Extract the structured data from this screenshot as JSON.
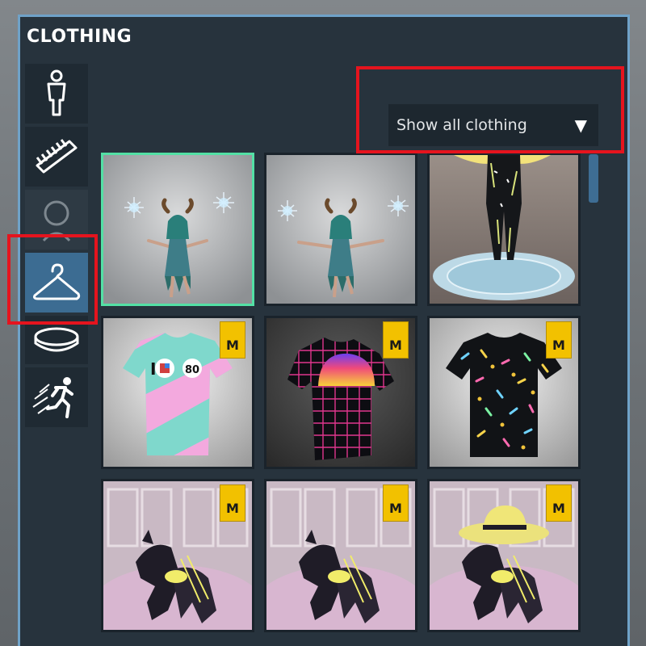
{
  "panel": {
    "title": "CLOTHING"
  },
  "sidebar": {
    "items": [
      {
        "icon": "body-icon",
        "state": "normal"
      },
      {
        "icon": "comb-icon",
        "state": "normal"
      },
      {
        "icon": "head-icon",
        "state": "dim"
      },
      {
        "icon": "hanger-icon",
        "state": "active"
      },
      {
        "icon": "ring-icon",
        "state": "normal"
      },
      {
        "icon": "running-icon",
        "state": "normal"
      }
    ]
  },
  "filter": {
    "selected": "Show all clothing",
    "arrow": "▼"
  },
  "tiles": [
    {
      "kind": "fairy-outfit",
      "badge": "",
      "selected": true
    },
    {
      "kind": "fairy-outfit",
      "badge": "",
      "selected": false
    },
    {
      "kind": "black-suit",
      "badge": "",
      "selected": false
    },
    {
      "kind": "pastel-tshirt",
      "badge": "M",
      "selected": false
    },
    {
      "kind": "grid-tshirt",
      "badge": "M",
      "selected": false
    },
    {
      "kind": "confetti-tshirt",
      "badge": "M",
      "selected": false
    },
    {
      "kind": "robot-dog",
      "badge": "M",
      "selected": false
    },
    {
      "kind": "robot-dog",
      "badge": "M",
      "selected": false
    },
    {
      "kind": "robot-dog-hat",
      "badge": "M",
      "selected": false
    }
  ],
  "tshirt_print": {
    "text": "I",
    "number": "80"
  },
  "colors": {
    "panel_bg": "#27333d",
    "panel_border": "#6fa2c8",
    "active_tab": "#3c6c92",
    "selected_tile": "#53e0a5",
    "badge": "#f2c100",
    "highlight": "#e5141e"
  }
}
